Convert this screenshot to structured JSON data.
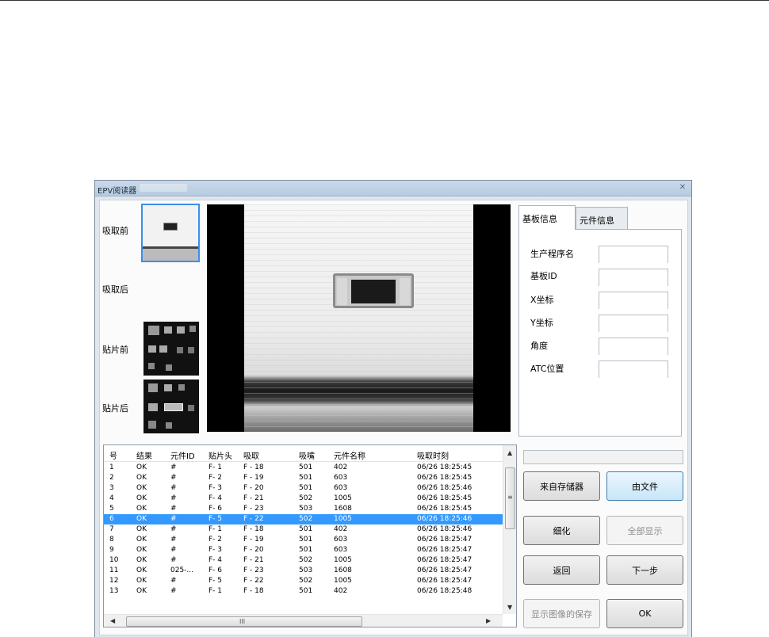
{
  "window": {
    "title": "EPV阅读器"
  },
  "thumbnails": {
    "before_pickup": "吸取前",
    "after_pickup": "吸取后",
    "before_place": "贴片前",
    "after_place": "贴片后"
  },
  "tabs": {
    "board_info": "基板信息",
    "component_info": "元件信息"
  },
  "board_fields": [
    {
      "label": "生产程序名",
      "value": ""
    },
    {
      "label": "基板ID",
      "value": ""
    },
    {
      "label": "X坐标",
      "value": ""
    },
    {
      "label": "Y坐标",
      "value": ""
    },
    {
      "label": "角度",
      "value": ""
    },
    {
      "label": "ATC位置",
      "value": ""
    }
  ],
  "table": {
    "columns": [
      "号",
      "结果",
      "元件ID",
      "贴片头",
      "吸取",
      "吸嘴",
      "元件名称",
      "吸取时刻"
    ],
    "rows": [
      [
        "1",
        "OK",
        "#",
        "F- 1",
        "F - 18",
        "501",
        "402",
        "06/26 18:25:45"
      ],
      [
        "2",
        "OK",
        "#",
        "F- 2",
        "F - 19",
        "501",
        "603",
        "06/26 18:25:45"
      ],
      [
        "3",
        "OK",
        "#",
        "F- 3",
        "F - 20",
        "501",
        "603",
        "06/26 18:25:46"
      ],
      [
        "4",
        "OK",
        "#",
        "F- 4",
        "F - 21",
        "502",
        "1005",
        "06/26 18:25:45"
      ],
      [
        "5",
        "OK",
        "#",
        "F- 6",
        "F - 23",
        "503",
        "1608",
        "06/26 18:25:45"
      ],
      [
        "6",
        "OK",
        "#",
        "F- 5",
        "F - 22",
        "502",
        "1005",
        "06/26 18:25:46"
      ],
      [
        "7",
        "OK",
        "#",
        "F- 1",
        "F - 18",
        "501",
        "402",
        "06/26 18:25:46"
      ],
      [
        "8",
        "OK",
        "#",
        "F- 2",
        "F - 19",
        "501",
        "603",
        "06/26 18:25:47"
      ],
      [
        "9",
        "OK",
        "#",
        "F- 3",
        "F - 20",
        "501",
        "603",
        "06/26 18:25:47"
      ],
      [
        "10",
        "OK",
        "#",
        "F- 4",
        "F - 21",
        "502",
        "1005",
        "06/26 18:25:47"
      ],
      [
        "11",
        "OK",
        "025-...",
        "F- 6",
        "F - 23",
        "503",
        "1608",
        "06/26 18:25:47"
      ],
      [
        "12",
        "OK",
        "#",
        "F- 5",
        "F - 22",
        "502",
        "1005",
        "06/26 18:25:47"
      ],
      [
        "13",
        "OK",
        "#",
        "F- 1",
        "F - 18",
        "501",
        "402",
        "06/26 18:25:48"
      ]
    ],
    "selected_row": 6
  },
  "buttons": {
    "from_memory": "来自存储器",
    "from_file": "由文件",
    "refine": "细化",
    "show_all": "全部显示",
    "back": "返回",
    "next": "下一步",
    "save_image": "显示图像的保存",
    "ok": "OK"
  },
  "scrollbar": {
    "grip": "III",
    "vgrip": "≡"
  },
  "colors": {
    "selection": "#3399ff",
    "focus_border": "#3d8fe6"
  }
}
